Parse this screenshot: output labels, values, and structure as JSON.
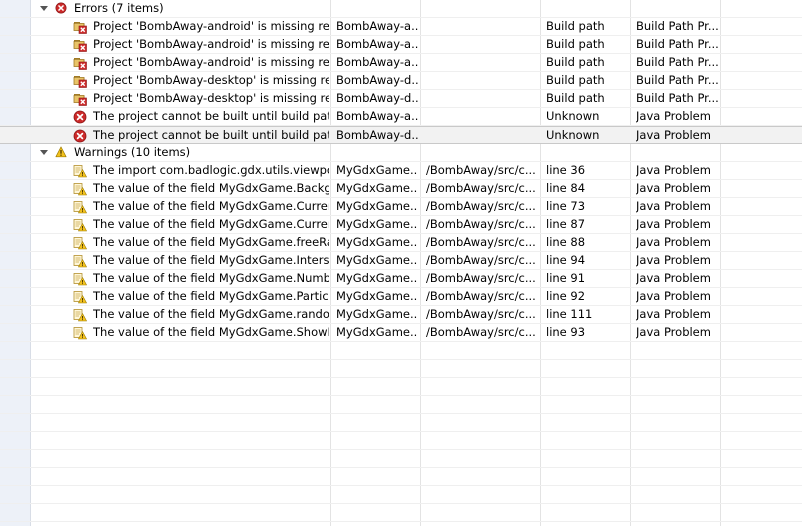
{
  "colors": {
    "error": "#cc2a2a",
    "warning": "#f3c21e",
    "gutter": "#edf1f8",
    "selected_row": "#f2f2f2"
  },
  "groups": [
    {
      "label": "Errors (7 items)",
      "icon": "error-icon",
      "items": [
        {
          "icon": "build-path-error-icon",
          "description": "Project 'BombAway-android' is missing required",
          "resource": "BombAway-a...",
          "path": "",
          "location": "Build path",
          "type": "Build Path Pr..."
        },
        {
          "icon": "build-path-error-icon",
          "description": "Project 'BombAway-android' is missing required",
          "resource": "BombAway-a...",
          "path": "",
          "location": "Build path",
          "type": "Build Path Pr..."
        },
        {
          "icon": "build-path-error-icon",
          "description": "Project 'BombAway-android' is missing required",
          "resource": "BombAway-a...",
          "path": "",
          "location": "Build path",
          "type": "Build Path Pr..."
        },
        {
          "icon": "build-path-error-icon",
          "description": "Project 'BombAway-desktop' is missing required",
          "resource": "BombAway-d...",
          "path": "",
          "location": "Build path",
          "type": "Build Path Pr..."
        },
        {
          "icon": "build-path-error-icon",
          "description": "Project 'BombAway-desktop' is missing required",
          "resource": "BombAway-d...",
          "path": "",
          "location": "Build path",
          "type": "Build Path Pr..."
        },
        {
          "icon": "error-icon",
          "description": "The project cannot be built until build path errors are resolved",
          "resource": "BombAway-a...",
          "path": "",
          "location": "Unknown",
          "type": "Java Problem"
        },
        {
          "icon": "error-icon",
          "description": "The project cannot be built until build path errors are resolved",
          "resource": "BombAway-d...",
          "path": "",
          "location": "Unknown",
          "type": "Java Problem",
          "selected": true
        }
      ]
    },
    {
      "label": "Warnings (10 items)",
      "icon": "warning-icon",
      "items": [
        {
          "icon": "java-warning-icon",
          "description": "The import com.badlogic.gdx.utils.viewport.FitViewport is never used",
          "resource": "MyGdxGame....",
          "path": "/BombAway/src/c...",
          "location": "line 36",
          "type": "Java Problem"
        },
        {
          "icon": "java-warning-icon",
          "description": "The value of the field MyGdxGame.Background is not used",
          "resource": "MyGdxGame....",
          "path": "/BombAway/src/c...",
          "location": "line 84",
          "type": "Java Problem"
        },
        {
          "icon": "java-warning-icon",
          "description": "The value of the field MyGdxGame.CurrentCount is not used",
          "resource": "MyGdxGame....",
          "path": "/BombAway/src/c...",
          "location": "line 73",
          "type": "Java Problem"
        },
        {
          "icon": "java-warning-icon",
          "description": "The value of the field MyGdxGame.CurrentCount is not used",
          "resource": "MyGdxGame....",
          "path": "/BombAway/src/c...",
          "location": "line 87",
          "type": "Java Problem"
        },
        {
          "icon": "java-warning-icon",
          "description": "The value of the field MyGdxGame.freeRandom is not used",
          "resource": "MyGdxGame....",
          "path": "/BombAway/src/c...",
          "location": "line 88",
          "type": "Java Problem"
        },
        {
          "icon": "java-warning-icon",
          "description": "The value of the field MyGdxGame.Interstitial is not used",
          "resource": "MyGdxGame....",
          "path": "/BombAway/src/c...",
          "location": "line 94",
          "type": "Java Problem"
        },
        {
          "icon": "java-warning-icon",
          "description": "The value of the field MyGdxGame.NumberCount is not used",
          "resource": "MyGdxGame....",
          "path": "/BombAway/src/c...",
          "location": "line 91",
          "type": "Java Problem"
        },
        {
          "icon": "java-warning-icon",
          "description": "The value of the field MyGdxGame.ParticleCount is not used",
          "resource": "MyGdxGame....",
          "path": "/BombAway/src/c...",
          "location": "line 92",
          "type": "Java Problem"
        },
        {
          "icon": "java-warning-icon",
          "description": "The value of the field MyGdxGame.random is not used",
          "resource": "MyGdxGame....",
          "path": "/BombAway/src/c...",
          "location": "line 111",
          "type": "Java Problem"
        },
        {
          "icon": "java-warning-icon",
          "description": "The value of the field MyGdxGame.ShowInterstitial is not used",
          "resource": "MyGdxGame....",
          "path": "/BombAway/src/c...",
          "location": "line 93",
          "type": "Java Problem"
        }
      ]
    }
  ]
}
